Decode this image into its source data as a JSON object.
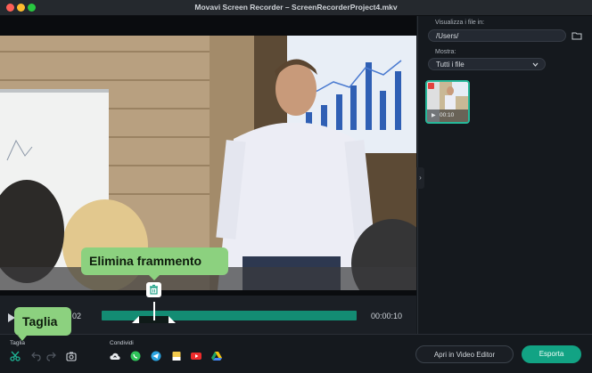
{
  "window": {
    "title": "Movavi Screen Recorder – ScreenRecorderProject4.mkv"
  },
  "sidebar": {
    "view_files_label": "Visualizza i file in:",
    "path_value": "/Users/",
    "show_label": "Mostra:",
    "filter_value": "Tutti i file",
    "thumbnail": {
      "duration": "00:10"
    }
  },
  "timeline": {
    "current_time": "02",
    "end_time": "00:00:10"
  },
  "tooltips": {
    "delete_fragment": "Elimina frammento",
    "cut": "Taglia"
  },
  "toolbar": {
    "cut_section_label": "Taglia",
    "share_section_label": "Condividi",
    "open_editor_label": "Apri in Video Editor",
    "export_label": "Esporta"
  },
  "colors": {
    "accent": "#12a384",
    "tooltip": "#8cd17f",
    "track": "#138c73"
  }
}
